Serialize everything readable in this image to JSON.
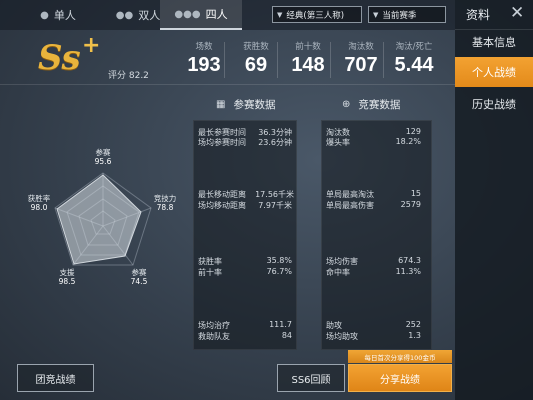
{
  "tabs": [
    {
      "label": "单人",
      "icon": "single-person-icon"
    },
    {
      "label": "双人",
      "icon": "duo-icon"
    },
    {
      "label": "四人",
      "icon": "squad-icon"
    }
  ],
  "dropdowns": {
    "mode": "经典(第三人称)",
    "season": "当前赛季"
  },
  "sidebar": {
    "title": "资料",
    "items": [
      "基本信息",
      "个人战绩",
      "历史战绩"
    ]
  },
  "rating": {
    "grade": "Ss",
    "plus": "+",
    "score_label": "评分 82.2"
  },
  "header_stats": [
    {
      "label": "场数",
      "value": "193"
    },
    {
      "label": "获胜数",
      "value": "69"
    },
    {
      "label": "前十数",
      "value": "148"
    },
    {
      "label": "淘汰数",
      "value": "707"
    },
    {
      "label": "淘汰/死亡",
      "value": "5.44"
    }
  ],
  "sections": {
    "participation": "参赛数据",
    "competition": "竞赛数据"
  },
  "radar": [
    {
      "label": "参赛",
      "value": "95.6"
    },
    {
      "label": "竞技力",
      "value": "78.8"
    },
    {
      "label": "参赛",
      "value": "74.5"
    },
    {
      "label": "支援",
      "value": "98.5"
    },
    {
      "label": "获胜率",
      "value": "98.0"
    }
  ],
  "participation_rows": [
    {
      "k": "最长参赛时间",
      "v": "36.3分钟"
    },
    {
      "k": "场均参赛时间",
      "v": "23.6分钟"
    },
    {
      "k": "最长移动距离",
      "v": "17.56千米"
    },
    {
      "k": "场均移动距离",
      "v": "7.97千米"
    },
    {
      "k": "获胜率",
      "v": "35.8%"
    },
    {
      "k": "前十率",
      "v": "76.7%"
    },
    {
      "k": "场均治疗",
      "v": "111.7"
    },
    {
      "k": "救助队友",
      "v": "84"
    }
  ],
  "competition_rows": [
    {
      "k": "淘汰数",
      "v": "129"
    },
    {
      "k": "爆头率",
      "v": "18.2%"
    },
    {
      "k": "单局最高淘汰",
      "v": "15"
    },
    {
      "k": "单局最高伤害",
      "v": "2579"
    },
    {
      "k": "场均伤害",
      "v": "674.3"
    },
    {
      "k": "命中率",
      "v": "11.3%"
    },
    {
      "k": "助攻",
      "v": "252"
    },
    {
      "k": "场均助攻",
      "v": "1.3"
    }
  ],
  "buttons": {
    "team_record": "团竞战绩",
    "season_review": "SS6回顾",
    "share": "分享战绩",
    "share_tip": "每日首次分享得100金币"
  },
  "colors": {
    "accent": "#e38a1a",
    "grade": "#e9b43c"
  }
}
